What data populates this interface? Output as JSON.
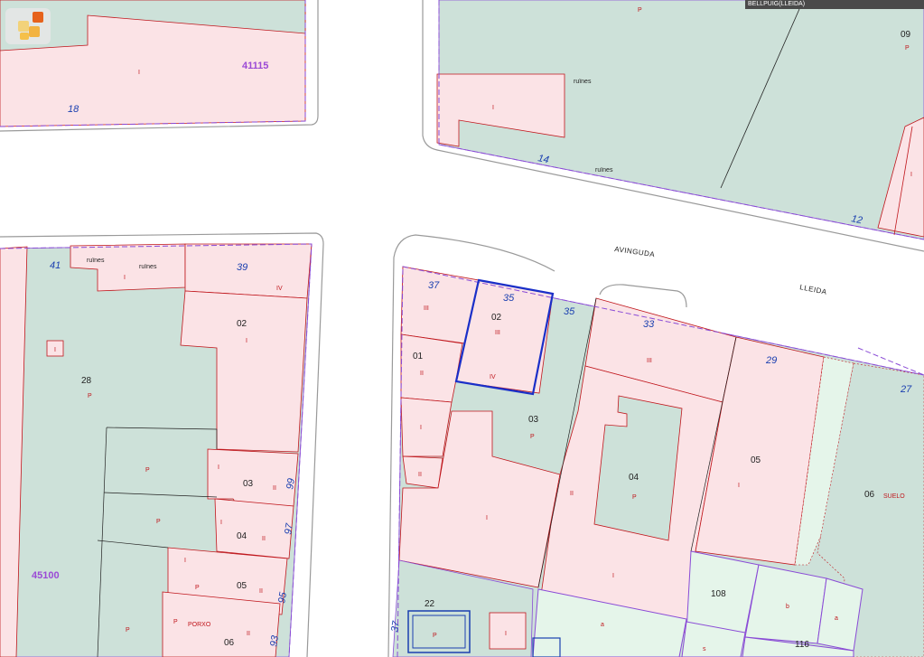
{
  "titlebar": {
    "text": "BELLPUIG(LLEIDA)"
  },
  "app": {
    "logo_icon": "app-logo-icon"
  },
  "streets": {
    "avinguda": "AVINGUDA",
    "lleida": "LLEIDA"
  },
  "blocks": {
    "b41115": "41115",
    "b45100": "45100"
  },
  "street_numbers": {
    "n18": "18",
    "n14": "14",
    "n12": "12",
    "n41": "41",
    "n39": "39",
    "n37a": "37",
    "n35a": "35",
    "n35b": "35",
    "n33": "33",
    "n29": "29",
    "n27": "27",
    "n99": "99",
    "n97": "97",
    "n95": "95",
    "n93": "93",
    "n37b": "37"
  },
  "parcels": {
    "p09": "09",
    "p02a": "02",
    "p28": "28",
    "p03a": "03",
    "p04a": "04",
    "p05a": "05",
    "p06a": "06",
    "p02b": "02",
    "p01": "01",
    "p03b": "03",
    "p04b": "04",
    "p05b": "05",
    "p06b": "06",
    "p22": "22",
    "p108": "108",
    "p116": "116"
  },
  "annotations": {
    "ruines1": "ruïnes",
    "ruines2": "ruïnes",
    "ruines3": "ruïnes",
    "ruines4": "ruïnes",
    "suelo": "SUELO",
    "porxo": "PORXO"
  },
  "floors": {
    "I": "I",
    "II": "II",
    "III": "III",
    "IV": "IV",
    "P": "P",
    "a": "a",
    "b": "b",
    "s": "s"
  },
  "colors": {
    "building": "#fbe3e6",
    "courtyard": "#cde1d9",
    "light_green": "#e5f5ea",
    "red_outline": "#c0161c",
    "purple_boundary": "#8a4bd6",
    "selected": "#1a2fc8"
  }
}
